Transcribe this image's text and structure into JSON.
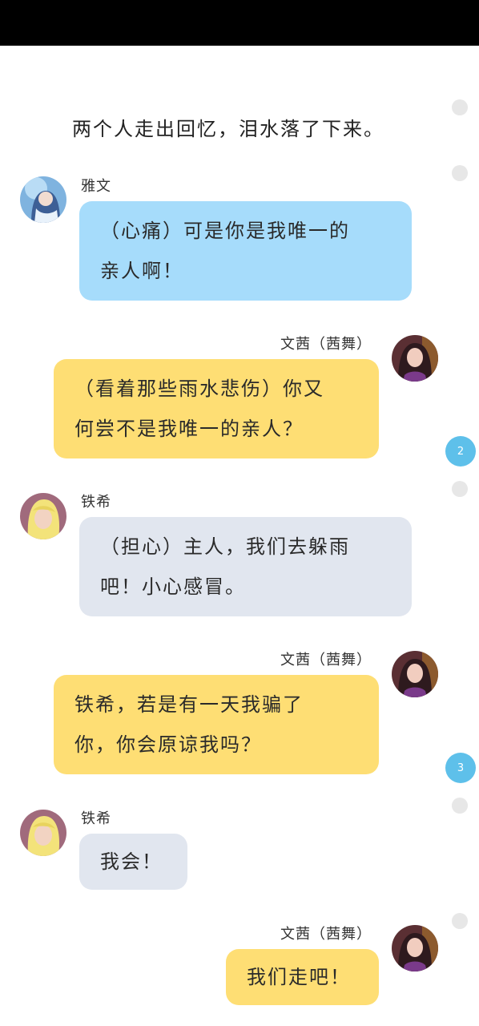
{
  "narration": "两个人走出回忆，泪水落了下来。",
  "messages": [
    {
      "speaker": "雅文",
      "lines": [
        "（心痛）可是你是我唯一的",
        "亲人啊！"
      ]
    },
    {
      "speaker": "文茜（茜舞）",
      "lines": [
        "（看着那些雨水悲伤）你又",
        "何尝不是我唯一的亲人？"
      ],
      "count": "2"
    },
    {
      "speaker": "铁希",
      "lines": [
        "（担心）主人，我们去躲雨",
        "吧！小心感冒。"
      ]
    },
    {
      "speaker": "文茜（茜舞）",
      "lines": [
        "铁希，若是有一天我骗了",
        "你，你会原谅我吗？"
      ],
      "count": "3"
    },
    {
      "speaker": "铁希",
      "lines": [
        "我会！"
      ]
    },
    {
      "speaker": "文茜（茜舞）",
      "lines": [
        "我们走吧！"
      ]
    }
  ],
  "colors": {
    "bubble_blue": "#a6dcfb",
    "bubble_yellow": "#fede74",
    "bubble_gray": "#e1e6ef",
    "badge": "#5ec0ea"
  },
  "icons": {
    "avatar_yawen": "blue-haired-girl-avatar",
    "avatar_wenqian": "dark-haired-girl-avatar",
    "avatar_tiexi": "blonde-girl-avatar"
  }
}
